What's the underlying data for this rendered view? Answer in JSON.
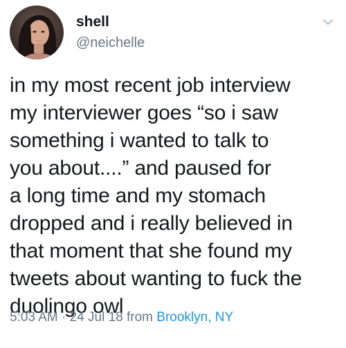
{
  "user": {
    "display_name": "shell",
    "handle": "@neichelle",
    "avatar_icon": "profile-photo"
  },
  "tweet": {
    "text": "in my most recent job interview\nmy interviewer goes “so i saw\nsomething i wanted to talk to\nyou about....” and paused for\na long time and my stomach\ndropped and i really believed in\nthat moment that she found my\ntweets about wanting to fuck the\nduolingo owl"
  },
  "meta": {
    "time": "5:03 AM",
    "separator": " · ",
    "date": "24 Jul 18",
    "from_label": " from ",
    "location": "Brooklyn, NY"
  },
  "menu": {
    "icon": "chevron-down-icon"
  },
  "colors": {
    "text": "#14171a",
    "secondary": "#657786",
    "link": "#1b95e0"
  }
}
